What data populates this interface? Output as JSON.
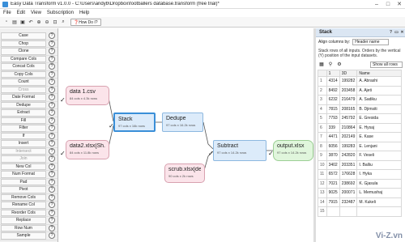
{
  "window": {
    "title": "Easy Data Transform v1.0.0 - C:\\Users\\andyb\\Dropbox\\footballers database.transform (free trial)*",
    "minimize": "–",
    "maximize": "□",
    "close": "✕"
  },
  "menu": [
    "File",
    "Edit",
    "View",
    "Subscription",
    "Help"
  ],
  "toolbar": {
    "howdoi": "How Do I?"
  },
  "sidebar": {
    "items": [
      {
        "label": "Case",
        "help": "?"
      },
      {
        "label": "Chop",
        "help": "?"
      },
      {
        "label": "Clone",
        "help": "?"
      },
      {
        "label": "Compare Cols",
        "help": "?"
      },
      {
        "label": "Concat Cols",
        "help": "?"
      },
      {
        "label": "Copy Cols",
        "help": "?"
      },
      {
        "label": "Count",
        "help": "?"
      },
      {
        "label": "Cross",
        "help": "?"
      },
      {
        "label": "Date Format",
        "help": "?"
      },
      {
        "label": "Dedupe",
        "help": "?"
      },
      {
        "label": "Extract",
        "help": "?"
      },
      {
        "label": "Fill",
        "help": "?"
      },
      {
        "label": "Filter",
        "help": "?"
      },
      {
        "label": "If",
        "help": "?"
      },
      {
        "label": "Insert",
        "help": "?"
      },
      {
        "label": "Intersect",
        "help": "?"
      },
      {
        "label": "Join",
        "help": "?"
      },
      {
        "label": "New Col",
        "help": "?"
      },
      {
        "label": "Num Format",
        "help": "?"
      },
      {
        "label": "Pad",
        "help": "?"
      },
      {
        "label": "Pivot",
        "help": "?"
      },
      {
        "label": "Remove Cols",
        "help": "?"
      },
      {
        "label": "Rename Col",
        "help": "?"
      },
      {
        "label": "Reorder Cols",
        "help": "?"
      },
      {
        "label": "Replace",
        "help": "?"
      },
      {
        "label": "Row Num",
        "help": "?"
      },
      {
        "label": "Sample",
        "help": "?"
      }
    ]
  },
  "nodes": {
    "data1": {
      "name": "data 1.csv",
      "info": "84 cols x 4.3k rows"
    },
    "data2": {
      "name": "data2.xlsx[Sh...",
      "info": "84 cols x 11.8k rows"
    },
    "stack": {
      "name": "Stack",
      "info": "97 cols x 16k rows"
    },
    "dedupe": {
      "name": "Dedupe",
      "info": "97 cols x 16.2k rows"
    },
    "scrub": {
      "name": "scrub.xlsx[det...",
      "info": "90 cols x 2k rows"
    },
    "subtract": {
      "name": "Subtract",
      "info": "97 cols x 14.2k rows"
    },
    "output": {
      "name": "output.xlsx",
      "info": "97 cols x 14.2k rows"
    }
  },
  "panel": {
    "title": "Stack",
    "align_label": "Align columns by:",
    "align_value": "Header name",
    "description": "Stack rows of all inputs. Orders by the vertical (Y) position of the input datasets.",
    "show_label": "Show all rows",
    "columns": [
      "",
      "1",
      "3D",
      "Name"
    ],
    "rows": [
      [
        "1",
        "4314",
        "199282",
        "A. Abrashi"
      ],
      [
        "2",
        "8492",
        "203458",
        "A. Ajeti"
      ],
      [
        "3",
        "6232",
        "216479",
        "A. Sadiku"
      ],
      [
        "4",
        "7815",
        "208165",
        "B. Djimsiti"
      ],
      [
        "5",
        "7793",
        "245792",
        "E. Gresida"
      ],
      [
        "6",
        "339",
        "210864",
        "E. Hysaj"
      ],
      [
        "7",
        "4471",
        "202149",
        "E. Kase"
      ],
      [
        "8",
        "6056",
        "199283",
        "E. Lenjani"
      ],
      [
        "9",
        "3870",
        "242820",
        "F. Veseli"
      ],
      [
        "10",
        "3402",
        "203351",
        "I. Balliu"
      ],
      [
        "11",
        "6572",
        "176628",
        "I. Hyka"
      ],
      [
        "12",
        "7021",
        "238692",
        "K. Gjasula"
      ],
      [
        "13",
        "9025",
        "200071",
        "L. Memushaj"
      ],
      [
        "14",
        "7915",
        "232487",
        "M. Kukeli"
      ],
      [
        "15",
        "",
        "",
        ""
      ]
    ]
  },
  "watermark": "Vi-Z.vn",
  "icons": [
    "app-icon",
    "new-icon",
    "open-icon",
    "save-icon",
    "undo-icon",
    "zoom-in-icon",
    "zoom-out-icon",
    "zoom-fit-icon",
    "search-icon",
    "help-icon"
  ]
}
